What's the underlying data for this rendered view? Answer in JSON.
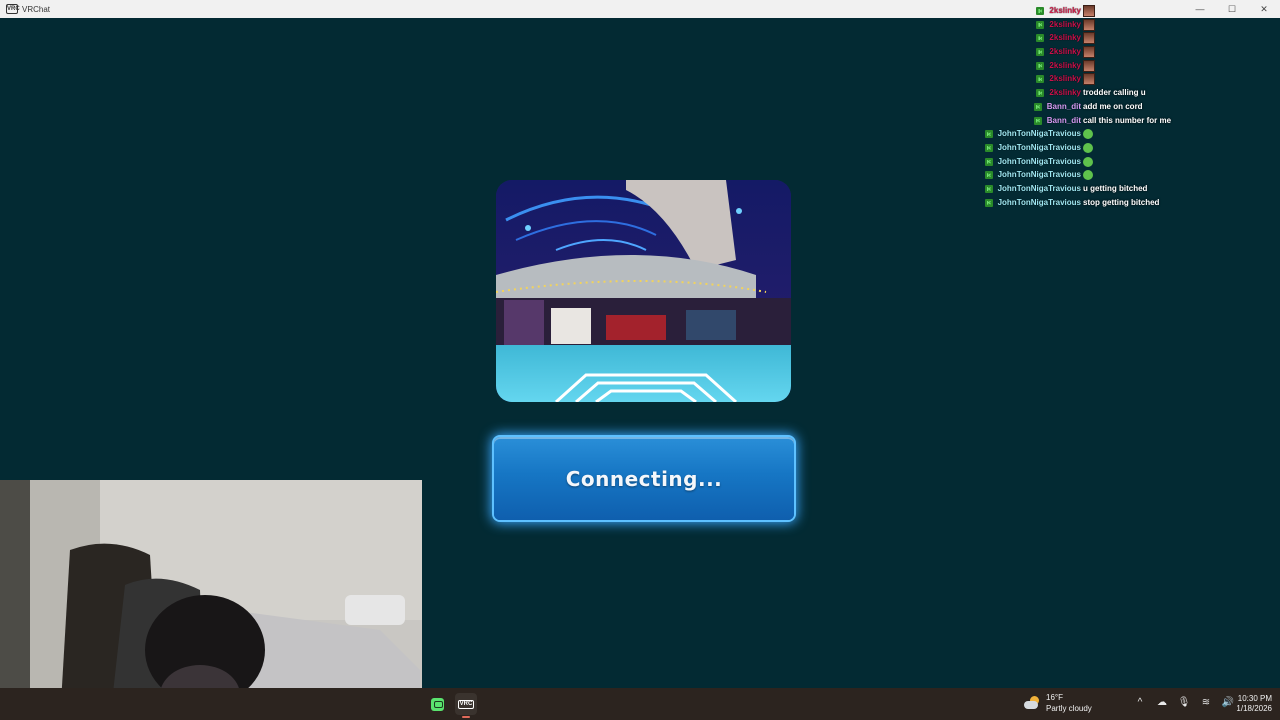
{
  "window": {
    "app_icon_text": "VRC",
    "title": "VRChat",
    "minimize": "—",
    "maximize": "☐",
    "close": "✕"
  },
  "chat": [
    {
      "user": "2kslinky",
      "user_color": "#d21f4b",
      "type": "emote-img"
    },
    {
      "user": "2kslinky",
      "user_color": "#c8114a",
      "type": "emote-img"
    },
    {
      "user": "2kslinky",
      "user_color": "#c8114a",
      "type": "emote-img"
    },
    {
      "user": "2kslinky",
      "user_color": "#c8114a",
      "type": "emote-img"
    },
    {
      "user": "2kslinky",
      "user_color": "#c8114a",
      "type": "emote-img"
    },
    {
      "user": "2kslinky",
      "user_color": "#c8114a",
      "type": "emote-img"
    },
    {
      "user": "2kslinky",
      "user_color": "#c8114a",
      "type": "text",
      "message": "trodder calling u"
    },
    {
      "user": "Bann_dit",
      "user_color": "#d59bf3",
      "type": "text",
      "message": "add me on cord"
    },
    {
      "user": "Bann_dit",
      "user_color": "#d59bf3",
      "type": "text",
      "message": "call this number for me"
    },
    {
      "user": "JohnTonNigaTravious",
      "user_color": "#9fe8f3",
      "type": "emote-face"
    },
    {
      "user": "JohnTonNigaTravious",
      "user_color": "#9fe8f3",
      "type": "emote-face"
    },
    {
      "user": "JohnTonNigaTravious",
      "user_color": "#9fe8f3",
      "type": "emote-face"
    },
    {
      "user": "JohnTonNigaTravious",
      "user_color": "#9fe8f3",
      "type": "emote-face"
    },
    {
      "user": "JohnTonNigaTravious",
      "user_color": "#9fe8f3",
      "type": "text",
      "message": "u getting bitched"
    },
    {
      "user": "JohnTonNigaTravious",
      "user_color": "#9fe8f3",
      "type": "text",
      "message": "stop getting bitched"
    }
  ],
  "connect": {
    "label": "Connecting..."
  },
  "taskbar": {
    "app1_icon": "chat-app-icon",
    "app2_text": "VRC",
    "weather_temp": "16°F",
    "weather_desc": "Partly cloudy",
    "tray_chevron": "^",
    "tray_cloud": "☁",
    "tray_mic": "🎙",
    "tray_wifi": "≋",
    "tray_volume": "🔊",
    "time": "10:30 PM",
    "date": "1/18/2026"
  },
  "colors": {
    "background": "#032a33",
    "button": "#1676c4",
    "taskbar": "#2c241f"
  }
}
